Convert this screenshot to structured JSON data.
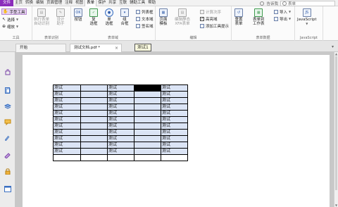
{
  "menubar": {
    "file": "文件",
    "items": [
      "主页",
      "转换",
      "编辑",
      "页面管理",
      "注释",
      "视图",
      "表单",
      "保护",
      "共享",
      "互联",
      "辅助工具",
      "帮助"
    ],
    "active_index": 7,
    "tellme": "告诉我",
    "search_placeholder": "表单"
  },
  "ribbon": {
    "tools_group": {
      "hand_tool": "手型工具",
      "select": "选择",
      "zoom": "缩放",
      "label": "工具"
    },
    "form_recognition": {
      "run_form_recognition": "执行表单\n自动识别",
      "design_assistant": "设计\n助手",
      "label": "表单识别"
    },
    "form_fields": {
      "button": "按钮",
      "checkbox": "复\n选框",
      "radio": "单\n选框",
      "combo": "组\n合框",
      "list_box": "列表框",
      "text_field": "文本域",
      "signature_field": "签名域",
      "label": "表单域"
    },
    "edit": {
      "page_template": "页面\n模板",
      "edit_static_xfa": "编辑静态\nXFA表单",
      "calc_order": "计算次序",
      "highlight_fields": "高亮域",
      "add_tooltip": "添加工具提示",
      "label": "编辑"
    },
    "form_data": {
      "reset_form": "重置\n表单",
      "export_form_to": "表单到\n工作表",
      "import": "导入",
      "export": "导出",
      "label": "表单数据"
    },
    "javascript": {
      "javascript_btn": "JavaScript",
      "label": "JavaScript"
    }
  },
  "doctabs": {
    "start": "开始",
    "document": "测试文档.pdf *"
  },
  "table": {
    "rows": [
      [
        "测试",
        "",
        "测试",
        "",
        "测试"
      ],
      [
        "测试",
        "",
        "测试",
        "",
        "测试"
      ],
      [
        "测试",
        "",
        "测试",
        "",
        "测试"
      ],
      [
        "测试",
        "",
        "测试",
        "",
        "测试"
      ],
      [
        "测试",
        "",
        "测试",
        "",
        "测试"
      ],
      [
        "测试",
        "",
        "测试",
        "",
        "测试"
      ],
      [
        "测试",
        "",
        "测试",
        "",
        "测试"
      ],
      [
        "测试",
        "",
        "测试",
        "",
        "测试"
      ],
      [
        "测试",
        "",
        "测试",
        "",
        "测试"
      ],
      [
        "测试",
        "",
        "测试",
        "",
        "测试"
      ],
      [
        "测试",
        "",
        "测试",
        "",
        "测试"
      ],
      [
        "",
        "",
        "",
        "",
        ""
      ]
    ]
  },
  "tooltip": "测试1",
  "colors": {
    "file_tab": "#8b2cbb",
    "field_fill": "#dbe4f5"
  }
}
